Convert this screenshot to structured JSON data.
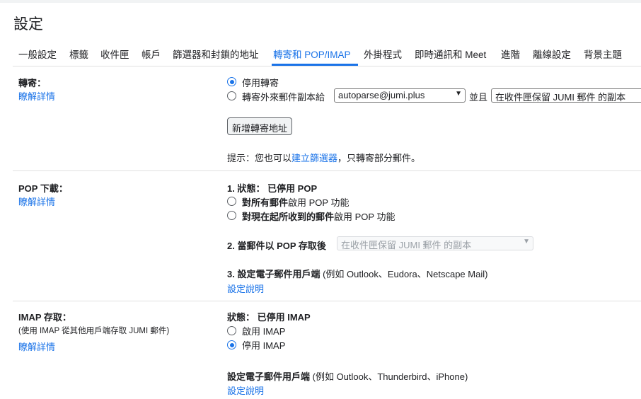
{
  "page": {
    "title": "設定"
  },
  "tabs": [
    {
      "label": "一般設定"
    },
    {
      "label": "標籤"
    },
    {
      "label": "收件匣"
    },
    {
      "label": "帳戶"
    },
    {
      "label": "篩選器和封鎖的地址"
    },
    {
      "label": "轉寄和 POP/IMAP"
    },
    {
      "label": "外掛程式"
    },
    {
      "label": "即時通訊和 Meet"
    },
    {
      "label": "進階"
    },
    {
      "label": "離線設定"
    },
    {
      "label": "背景主題"
    }
  ],
  "forwarding": {
    "label": "轉寄：",
    "learn_more": "瞭解詳情",
    "option_disable": "停用轉寄",
    "option_forward": "轉寄外來郵件副本給",
    "forward_address": "autoparse@jumi.plus",
    "and": "並且",
    "keep_option": "在收件匣保留 JUMI 郵件 的副本",
    "add_button": "新增轉寄地址",
    "tip_prefix": "提示：您也可以",
    "tip_link": "建立篩選器",
    "tip_suffix": "，只轉寄部分郵件。"
  },
  "pop": {
    "label": "POP 下載：",
    "learn_more": "瞭解詳情",
    "status": "1. 狀態： 已停用 POP",
    "opt1_bold": "對所有郵件",
    "opt1_rest": "啟用 POP 功能",
    "opt2_bold": "對現在起所收到的郵件",
    "opt2_rest": "啟用 POP 功能",
    "step2": "2. 當郵件以 POP 存取後",
    "step2_select": "在收件匣保留 JUMI 郵件 的副本",
    "step3_bold": "3. 設定電子郵件用戶端",
    "step3_rest": " (例如 Outlook、Eudora、Netscape Mail)",
    "setup_link": "設定說明"
  },
  "imap": {
    "label": "IMAP 存取：",
    "sublabel": "(使用 IMAP 從其他用戶端存取 JUMI 郵件)",
    "learn_more": "瞭解詳情",
    "status": "狀態： 已停用 IMAP",
    "opt_enable": "啟用 IMAP",
    "opt_disable": "停用 IMAP",
    "client_bold": "設定電子郵件用戶端",
    "client_rest": " (例如 Outlook、Thunderbird、iPhone)",
    "setup_link": "設定說明"
  },
  "colors": {
    "accent": "#1a73e8",
    "text": "#202124",
    "divider": "#e0e0e0"
  },
  "icons": {
    "select_chevron": "chevron-down-icon"
  }
}
